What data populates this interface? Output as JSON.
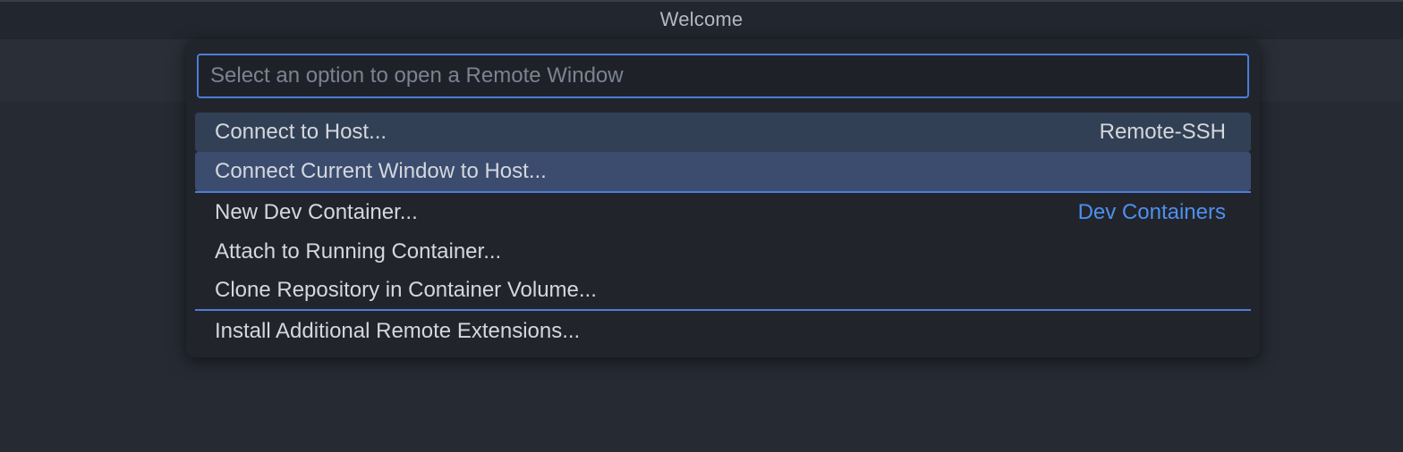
{
  "window": {
    "title": "Welcome"
  },
  "quick_pick": {
    "placeholder": "Select an option to open a Remote Window",
    "value": "",
    "items": [
      {
        "label": "Connect to Host...",
        "description": "Remote-SSH",
        "state": "hover"
      },
      {
        "label": "Connect Current Window to Host...",
        "description": "",
        "state": "selected"
      },
      {
        "label": "New Dev Container...",
        "description": "Dev Containers",
        "state": ""
      },
      {
        "label": "Attach to Running Container...",
        "description": "",
        "state": ""
      },
      {
        "label": "Clone Repository in Container Volume...",
        "description": "",
        "state": ""
      },
      {
        "label": "Install Additional Remote Extensions...",
        "description": "",
        "state": ""
      }
    ]
  },
  "colors": {
    "background": "#262a33",
    "titlebar": "#22262e",
    "quick_pick_bg": "#21252b",
    "focus_border": "#4c7cd9",
    "selected_row": "#3b4c6e",
    "hover_row": "#324055",
    "group_label_accent": "#4f8fef"
  }
}
